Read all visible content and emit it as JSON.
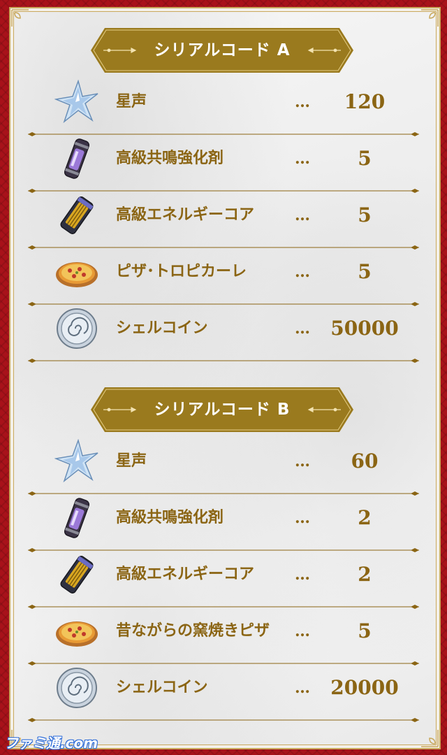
{
  "sections": [
    {
      "title": "シリアルコード A",
      "rows": [
        {
          "icon": "star-crystal-icon",
          "name": "星声",
          "dots": "…",
          "qty": "120"
        },
        {
          "icon": "resonance-enhancer-icon",
          "name": "高級共鳴強化剤",
          "dots": "…",
          "qty": "5"
        },
        {
          "icon": "energy-core-icon",
          "name": "高級エネルギーコア",
          "dots": "…",
          "qty": "5"
        },
        {
          "icon": "pizza-icon",
          "name": "ピザ･トロピカーレ",
          "dots": "…",
          "qty": "5"
        },
        {
          "icon": "shell-coin-icon",
          "name": "シェルコイン",
          "dots": "…",
          "qty": "50000"
        }
      ]
    },
    {
      "title": "シリアルコード B",
      "rows": [
        {
          "icon": "star-crystal-icon",
          "name": "星声",
          "dots": "…",
          "qty": "60"
        },
        {
          "icon": "resonance-enhancer-icon",
          "name": "高級共鳴強化剤",
          "dots": "…",
          "qty": "2"
        },
        {
          "icon": "energy-core-icon",
          "name": "高級エネルギーコア",
          "dots": "…",
          "qty": "2"
        },
        {
          "icon": "pizza-icon",
          "name": "昔ながらの窯焼きピザ",
          "dots": "…",
          "qty": "5"
        },
        {
          "icon": "shell-coin-icon",
          "name": "シェルコイン",
          "dots": "…",
          "qty": "20000"
        }
      ]
    }
  ],
  "watermark": "ファミ通.com",
  "colors": {
    "gold": "#8b6514",
    "banner": "#9a7a1e",
    "frame": "#a8121a"
  }
}
